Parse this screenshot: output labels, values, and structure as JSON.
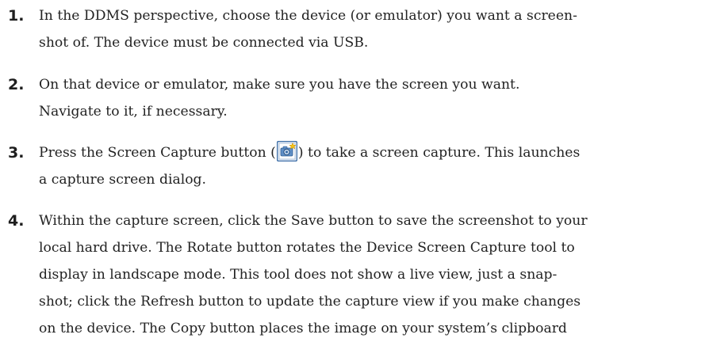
{
  "steps": [
    {
      "number": "1.",
      "lines": [
        "In the DDMS perspective,  choose the device (or emulator) you want a screen-",
        "shot of. The device must be connected via USB."
      ]
    },
    {
      "number": "2.",
      "lines": [
        "On that device or emulator, make sure you have the screen you want.",
        "Navigate to it, if necessary."
      ]
    },
    {
      "number": "3.",
      "line1_before_icon": "Press the Screen Capture button (",
      "line1_after_icon": ") to take a screen capture. This launches",
      "icon": "camera-capture-icon",
      "lines": [
        "a capture screen dialog."
      ]
    },
    {
      "number": "4.",
      "lines": [
        "Within the capture screen, click the Save button to save the screenshot to your",
        "local hard drive. The Rotate button rotates the Device Screen Capture tool to",
        "display in landscape mode. This tool does not show a live view, just a snap-",
        "shot; click the Refresh button to update the capture view if you make changes",
        "on the device. The Copy button places the image on your system’s clipboard"
      ]
    }
  ],
  "colors": {
    "text": "#222222",
    "number": "#1e1e1e",
    "icon_frame": "#3d6fa8",
    "icon_fill": "#cfe0f3",
    "icon_star": "#f3c21b"
  }
}
